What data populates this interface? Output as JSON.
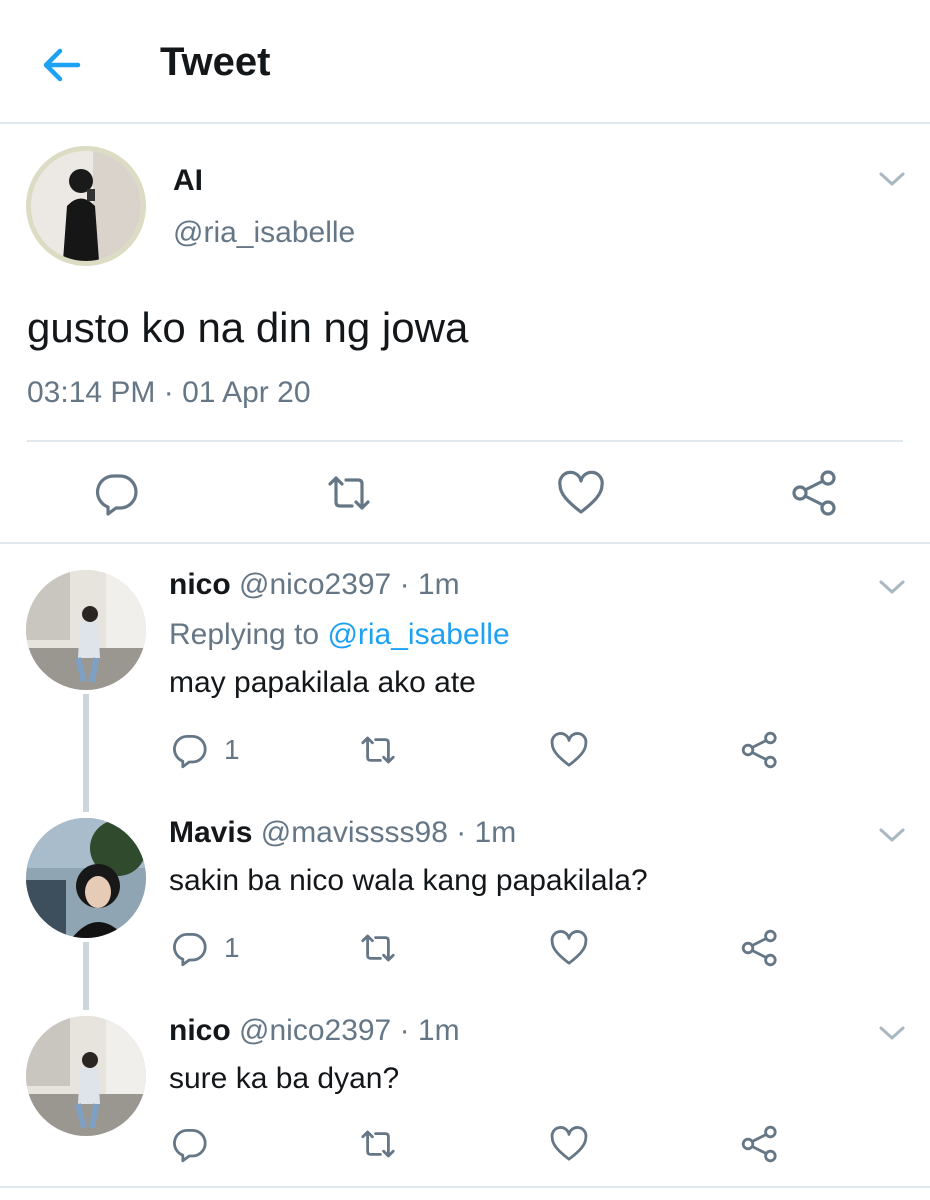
{
  "header": {
    "title": "Tweet",
    "back_icon": "arrow-left-icon",
    "accent": "#1da1f2"
  },
  "main_tweet": {
    "name": "AI",
    "handle": "@ria_isabelle",
    "text": "gusto ko na din ng jowa",
    "timestamp": "03:14 PM · 01 Apr 20",
    "icons": [
      "reply-icon",
      "retweet-icon",
      "like-icon",
      "share-icon"
    ]
  },
  "replies": [
    {
      "name": "nico",
      "meta": "@nico2397 · 1m",
      "replying_prefix": "Replying to ",
      "replying_handle": "@ria_isabelle",
      "text": "may papakilala ako ate",
      "reply_count": "1"
    },
    {
      "name": "Mavis",
      "meta": "@mavissss98 · 1m",
      "text": "sakin ba nico wala kang papakilala?",
      "reply_count": "1"
    },
    {
      "name": "nico",
      "meta": "@nico2397 · 1m",
      "text": "sure ka ba dyan?",
      "reply_count": ""
    }
  ],
  "colors": {
    "secondary_text": "#657786",
    "divider": "#e1e8ed",
    "thread_line": "#ccd6dd",
    "icon": "#657786"
  }
}
